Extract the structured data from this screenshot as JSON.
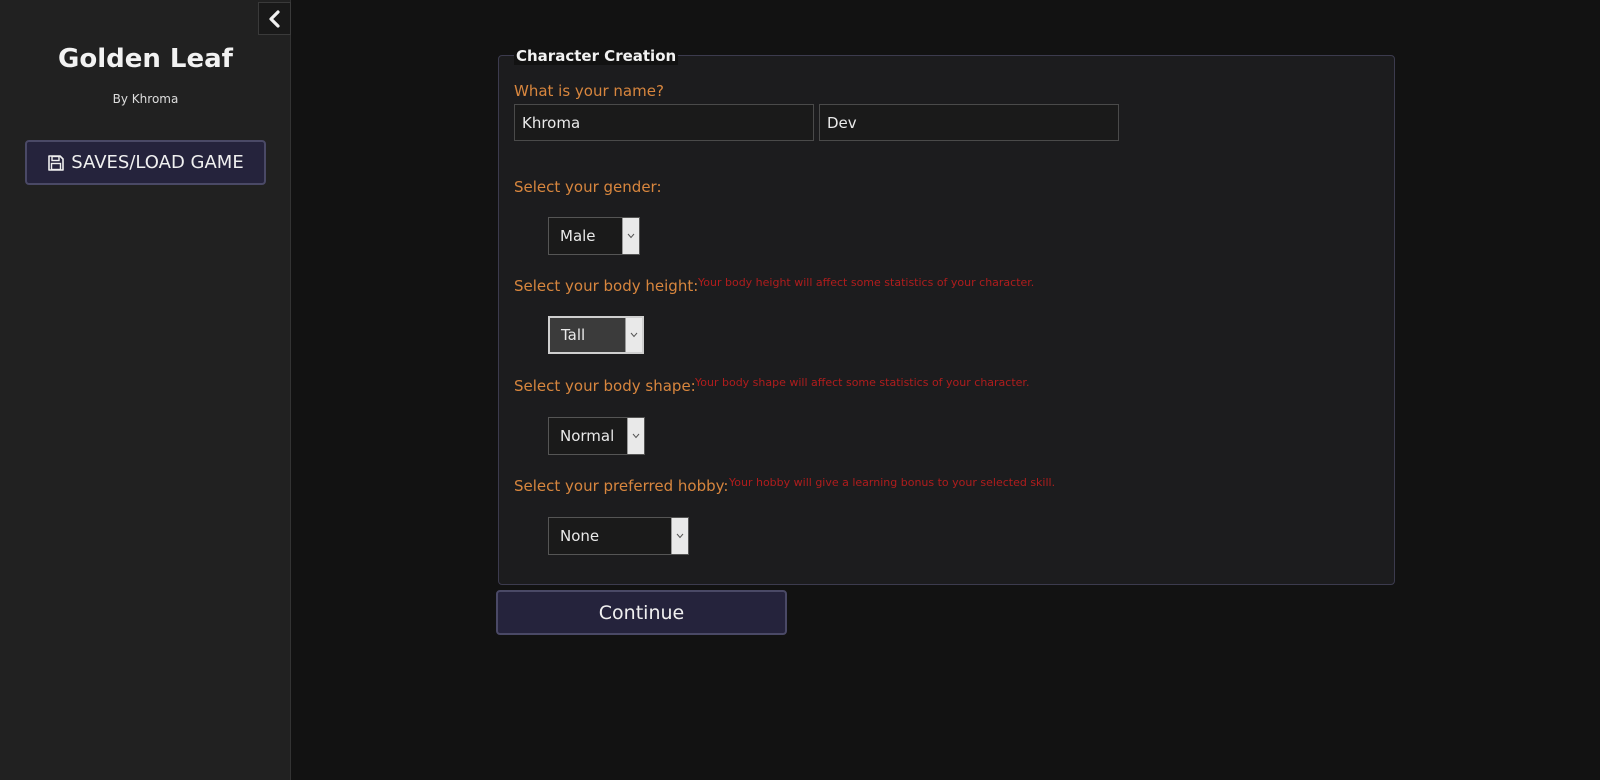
{
  "sidebar": {
    "title": "Golden Leaf",
    "author": "By Khroma",
    "saves_button_label": "SAVES/LOAD GAME",
    "collapse_icon": "chevron-left-icon",
    "saves_icon": "floppy-disk-icon"
  },
  "form": {
    "title": "Character Creation",
    "name": {
      "label": "What is your name?",
      "first_name": "Khroma",
      "last_name": "Dev"
    },
    "gender": {
      "label": "Select your gender:",
      "selected": "Male"
    },
    "body_height": {
      "label": "Select your body height:",
      "hint": "Your body height will affect some statistics of your character.",
      "selected": "Tall"
    },
    "body_shape": {
      "label": "Select your body shape:",
      "hint": "Your body shape will affect some statistics of your character.",
      "selected": "Normal"
    },
    "hobby": {
      "label": "Select your preferred hobby:",
      "hint": "Your hobby will give a learning bonus to your selected skill.",
      "selected": "None"
    },
    "continue_label": "Continue"
  },
  "colors": {
    "background": "#121212",
    "sidebar": "#212121",
    "label_orange": "#d8863e",
    "hint_red": "#b01d1d",
    "button_bg": "#25233c"
  }
}
